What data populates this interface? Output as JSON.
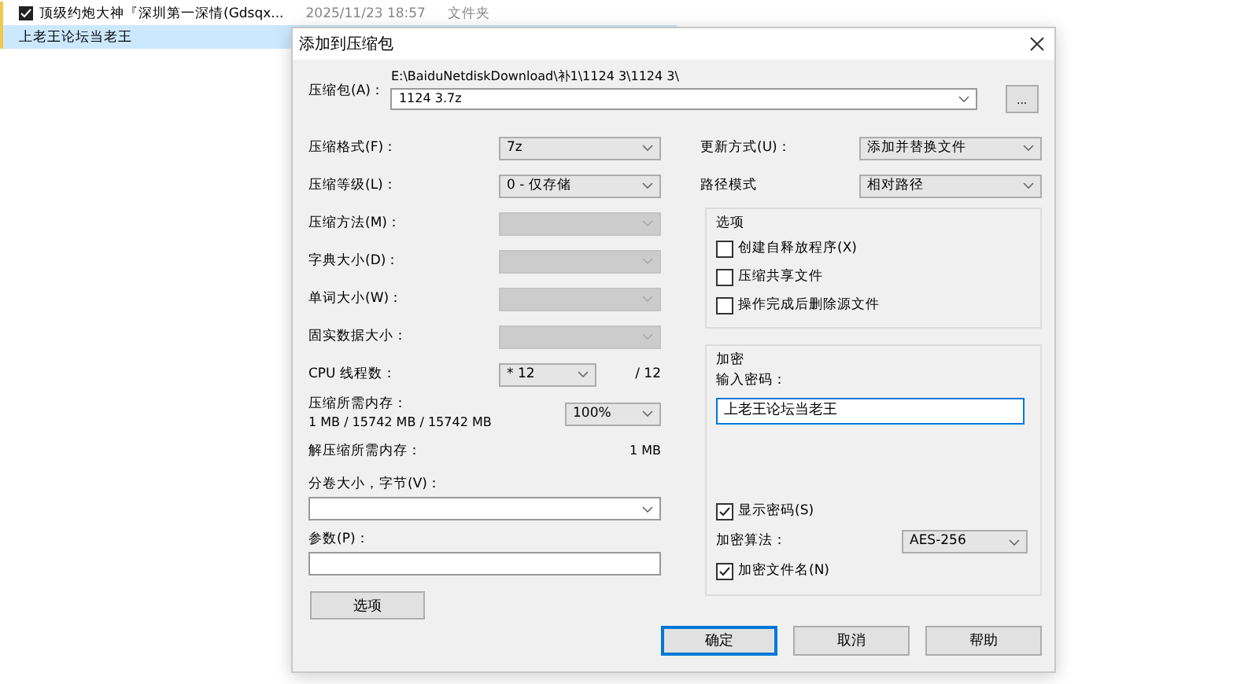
{
  "file_list": {
    "rows": [
      {
        "name": "顶级约炮大神『深圳第一深情(Gdsqx...",
        "date": "2025/11/23 18:57",
        "type": "文件夹",
        "checked": true,
        "selected": false
      },
      {
        "name": "上老王论坛当老王",
        "checked": false,
        "selected": true
      }
    ]
  },
  "dialog": {
    "title": "添加到压缩包",
    "archive": {
      "label": "压缩包(A)：",
      "path": "E:\\BaiduNetdiskDownload\\补1\\1124 3\\1124 3\\",
      "value": "1124 3.7z",
      "browse": "..."
    },
    "left_rows": [
      {
        "kind": "combo",
        "label": "压缩格式(F)：",
        "value": "7z",
        "disabled": false
      },
      {
        "kind": "combo",
        "label": "压缩等级(L)：",
        "value": "0 - 仅存储",
        "disabled": false
      },
      {
        "kind": "combo",
        "label": "压缩方法(M)：",
        "disabled": true
      },
      {
        "kind": "combo",
        "label": "字典大小(D)：",
        "disabled": true
      },
      {
        "kind": "combo",
        "label": "单词大小(W)：",
        "disabled": true
      },
      {
        "kind": "combo",
        "label": "固实数据大小：",
        "disabled": true
      },
      {
        "kind": "threads",
        "label": "CPU 线程数：",
        "value": "* 12",
        "total": "/ 12"
      },
      {
        "kind": "memory",
        "label": "压缩所需内存：",
        "detail": "1 MB / 15742 MB / 15742 MB",
        "value": "100%"
      },
      {
        "kind": "info",
        "label": "解压缩所需内存：",
        "value": "1 MB"
      }
    ],
    "volume": {
      "label": "分卷大小，字节(V)："
    },
    "params": {
      "label": "参数(P)："
    },
    "options_button": "选项",
    "right_rows": [
      {
        "label": "更新方式(U)：",
        "value": "添加并替换文件"
      },
      {
        "label": "路径模式",
        "value": "相对路径"
      }
    ],
    "options_group": {
      "title": "选项",
      "items": [
        {
          "label": "创建自释放程序(X)",
          "checked": false
        },
        {
          "label": "压缩共享文件",
          "checked": false
        },
        {
          "label": "操作完成后删除源文件",
          "checked": false
        }
      ]
    },
    "encryption": {
      "title": "加密",
      "password_label": "输入密码：",
      "password": "上老王论坛当老王",
      "show_password": {
        "label": "显示密码(S)",
        "checked": true
      },
      "method_label": "加密算法：",
      "method": "AES-256",
      "encrypt_names": {
        "label": "加密文件名(N)",
        "checked": true
      }
    },
    "buttons": [
      {
        "label": "确定",
        "default": true
      },
      {
        "label": "取消",
        "default": false
      },
      {
        "label": "帮助",
        "default": false
      }
    ]
  }
}
